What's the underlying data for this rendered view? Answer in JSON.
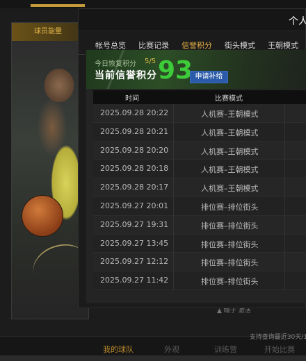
{
  "modal": {
    "title": "个人",
    "tabs": [
      {
        "label": "帐号总览"
      },
      {
        "label": "比赛记录"
      },
      {
        "label": "信誉积分"
      },
      {
        "label": "街头模式"
      },
      {
        "label": "王朝模式"
      }
    ],
    "active_tab": "信誉积分"
  },
  "credit": {
    "recover_label": "今日恢复积分",
    "recover_count": "5/5",
    "label": "当前信誉积分",
    "value": "93",
    "apply_button": "申请补给"
  },
  "table": {
    "headers": [
      "时间",
      "比赛模式"
    ],
    "rows": [
      {
        "time": "2025.09.28  20:22",
        "mode": "人机赛–王朝模式"
      },
      {
        "time": "2025.09.28  20:21",
        "mode": "人机赛–王朝模式"
      },
      {
        "time": "2025.09.28  20:20",
        "mode": "人机赛–王朝模式"
      },
      {
        "time": "2025.09.28  20:18",
        "mode": "人机赛–王朝模式"
      },
      {
        "time": "2025.09.28  20:17",
        "mode": "人机赛–王朝模式"
      },
      {
        "time": "2025.09.27  20:01",
        "mode": "排位赛–排位街头"
      },
      {
        "time": "2025.09.27  19:31",
        "mode": "排位赛–排位街头"
      },
      {
        "time": "2025.09.27  13:45",
        "mode": "排位赛–排位街头"
      },
      {
        "time": "2025.09.27  12:12",
        "mode": "排位赛–排位街头"
      },
      {
        "time": "2025.09.27  11:42",
        "mode": "排位赛–排位街头"
      }
    ],
    "footer_note": "支持查询最近30天/1"
  },
  "background": {
    "card_label": "球员能量",
    "bottom_nav": [
      "我的球队",
      "外观",
      "训练营",
      "开始比赛"
    ],
    "side_text": "▲ 帽子 激活"
  },
  "colors": {
    "accent_gold": "#e8b445",
    "credit_green": "#3ecb3a",
    "apply_blue": "#2a5aa8"
  }
}
